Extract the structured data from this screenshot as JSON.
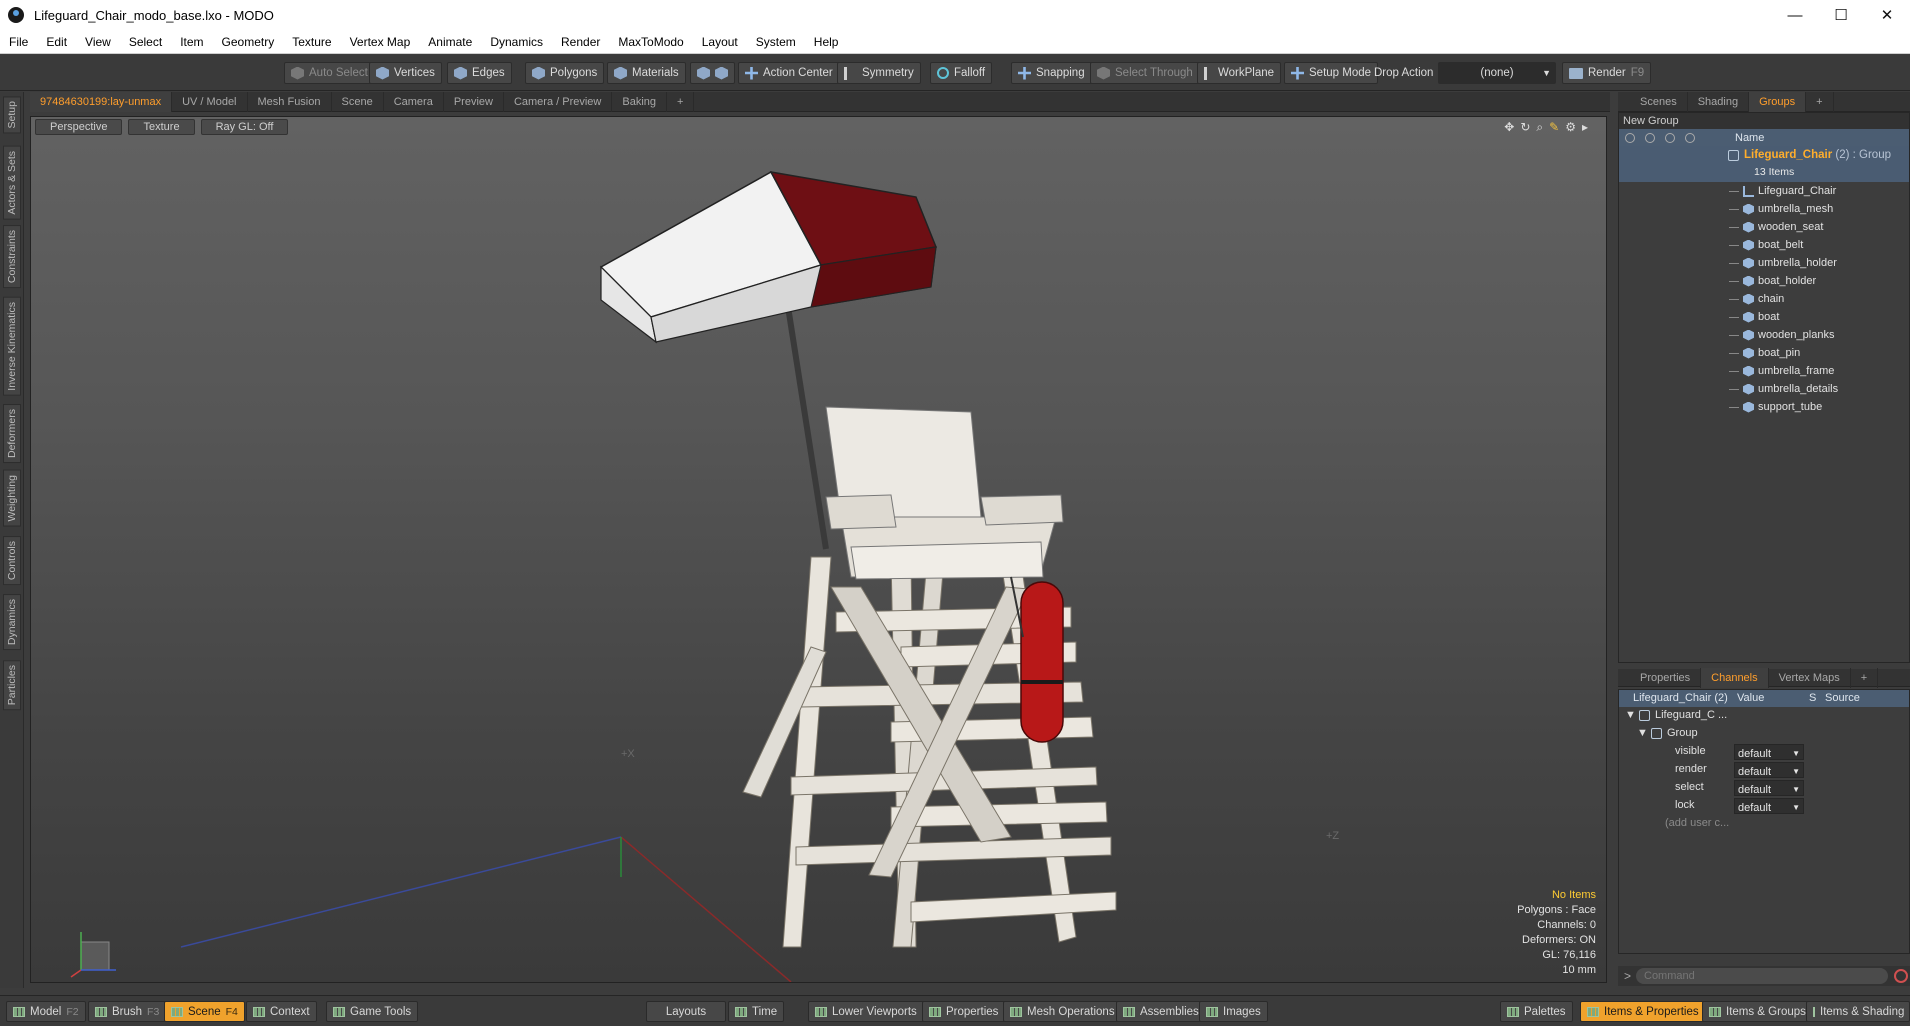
{
  "window": {
    "title": "Lifeguard_Chair_modo_base.lxo - MODO",
    "controls": [
      "—",
      "☐",
      "✕"
    ]
  },
  "menu": [
    "File",
    "Edit",
    "View",
    "Select",
    "Item",
    "Geometry",
    "Texture",
    "Vertex Map",
    "Animate",
    "Dynamics",
    "Render",
    "MaxToModo",
    "Layout",
    "System",
    "Help"
  ],
  "toolbar": {
    "auto_select": "Auto Select",
    "vertices": "Vertices",
    "edges": "Edges",
    "polygons": "Polygons",
    "materials": "Materials",
    "action_center": "Action Center",
    "symmetry": "Symmetry",
    "falloff": "Falloff",
    "snapping": "Snapping",
    "select_through": "Select Through",
    "workplane": "WorkPlane",
    "setup_mode": "Setup Mode",
    "drop_action": "Drop Action",
    "drop_value": "(none)",
    "render": "Render",
    "render_key": "F9"
  },
  "left_tabs": [
    "Setup",
    "Actors & Sets",
    "Constraints",
    "Inverse Kinematics",
    "Deformers",
    "Weighting",
    "Controls",
    "Dynamics",
    "Particles"
  ],
  "viewport_tabs": [
    "97484630199:lay-unmax",
    "UV / Model",
    "Mesh Fusion",
    "Scene",
    "Camera",
    "Preview",
    "Camera / Preview",
    "Baking",
    "+"
  ],
  "viewport": {
    "view_buttons": [
      "Perspective",
      "Texture",
      "Ray GL: Off"
    ],
    "info": {
      "selection": "No Items",
      "polygons": "Polygons : Face",
      "channels": "Channels: 0",
      "deformers": "Deformers: ON",
      "gl": "GL: 76,116",
      "scale": "10 mm"
    }
  },
  "scene_tabs": [
    "Scenes",
    "Shading",
    "Groups",
    "+"
  ],
  "groups": {
    "new_group": "New Group",
    "col_name": "Name",
    "group_name": "Lifeguard_Chair",
    "group_suffix": "(2) : Group",
    "count": "13 Items",
    "items": [
      "Lifeguard_Chair",
      "umbrella_mesh",
      "wooden_seat",
      "boat_belt",
      "umbrella_holder",
      "boat_holder",
      "chain",
      "boat",
      "wooden_planks",
      "boat_pin",
      "umbrella_frame",
      "umbrella_details",
      "support_tube"
    ]
  },
  "props_tabs": [
    "Properties",
    "Channels",
    "Vertex Maps",
    "+"
  ],
  "channels": {
    "col_item": "Lifeguard_Chair (2)",
    "col_value": "Value",
    "col_s": "S",
    "col_source": "Source",
    "root": "Lifeguard_C ...",
    "group": "Group",
    "rows": [
      {
        "name": "visible",
        "value": "default"
      },
      {
        "name": "render",
        "value": "default"
      },
      {
        "name": "select",
        "value": "default"
      },
      {
        "name": "lock",
        "value": "default"
      }
    ],
    "add_user": "(add user c..."
  },
  "command": {
    "prompt": ">",
    "placeholder": "Command"
  },
  "bottom": {
    "model": "Model",
    "model_key": "F2",
    "brush": "Brush",
    "brush_key": "F3",
    "scene": "Scene",
    "scene_key": "F4",
    "context": "Context",
    "game_tools": "Game Tools",
    "layouts": "Layouts",
    "time": "Time",
    "lower_viewports": "Lower Viewports",
    "properties": "Properties",
    "mesh_operations": "Mesh Operations",
    "assemblies": "Assemblies",
    "images": "Images",
    "palettes": "Palettes",
    "items_properties": "Items & Properties",
    "items_groups": "Items & Groups",
    "items_shading": "Items & Shading"
  },
  "colors": {
    "accent_orange": "#f0a22c",
    "umbrella_red": "#7a1418",
    "boat_red": "#b81818",
    "selection_blue": "#4b5d72"
  }
}
